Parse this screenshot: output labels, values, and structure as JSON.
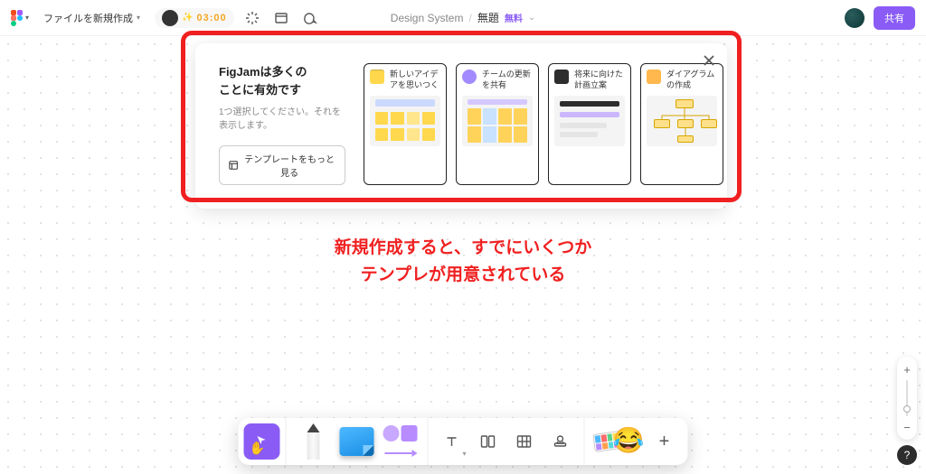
{
  "header": {
    "file_menu_label": "ファイルを新規作成",
    "timer_value": "03:00",
    "project_name": "Design System",
    "separator": "/",
    "file_name": "無題",
    "plan_badge": "無料",
    "share_label": "共有"
  },
  "panel": {
    "title_line1": "FigJamは多くの",
    "title_line2": "ことに有効です",
    "subtitle": "1つ選択してください。それを表示します。",
    "more_templates_label": "テンプレートをもっと見る",
    "cards": [
      {
        "title": "新しいアイデアを思いつく"
      },
      {
        "title": "チームの更新を共有"
      },
      {
        "title": "将来に向けた計画立案"
      },
      {
        "title": "ダイアグラムの作成"
      }
    ]
  },
  "annotation": {
    "line1": "新規作成すると、すでにいくつか",
    "line2": "テンプレが用意されている"
  },
  "toolbar": {
    "plus_label": "+"
  },
  "help_label": "?"
}
